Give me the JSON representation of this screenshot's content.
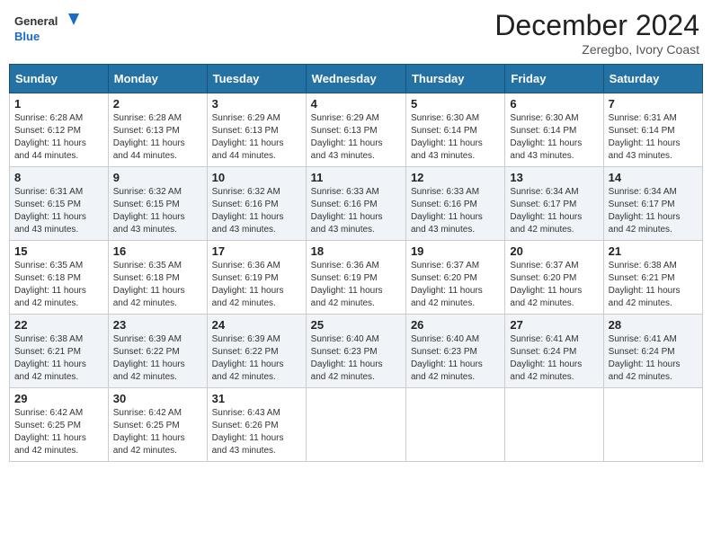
{
  "header": {
    "logo_general": "General",
    "logo_blue": "Blue",
    "month_title": "December 2024",
    "subtitle": "Zeregbo, Ivory Coast"
  },
  "days_of_week": [
    "Sunday",
    "Monday",
    "Tuesday",
    "Wednesday",
    "Thursday",
    "Friday",
    "Saturday"
  ],
  "weeks": [
    [
      {
        "day": 1,
        "sunrise": "6:28 AM",
        "sunset": "6:12 PM",
        "daylight": "11 hours and 44 minutes."
      },
      {
        "day": 2,
        "sunrise": "6:28 AM",
        "sunset": "6:13 PM",
        "daylight": "11 hours and 44 minutes."
      },
      {
        "day": 3,
        "sunrise": "6:29 AM",
        "sunset": "6:13 PM",
        "daylight": "11 hours and 44 minutes."
      },
      {
        "day": 4,
        "sunrise": "6:29 AM",
        "sunset": "6:13 PM",
        "daylight": "11 hours and 43 minutes."
      },
      {
        "day": 5,
        "sunrise": "6:30 AM",
        "sunset": "6:14 PM",
        "daylight": "11 hours and 43 minutes."
      },
      {
        "day": 6,
        "sunrise": "6:30 AM",
        "sunset": "6:14 PM",
        "daylight": "11 hours and 43 minutes."
      },
      {
        "day": 7,
        "sunrise": "6:31 AM",
        "sunset": "6:14 PM",
        "daylight": "11 hours and 43 minutes."
      }
    ],
    [
      {
        "day": 8,
        "sunrise": "6:31 AM",
        "sunset": "6:15 PM",
        "daylight": "11 hours and 43 minutes."
      },
      {
        "day": 9,
        "sunrise": "6:32 AM",
        "sunset": "6:15 PM",
        "daylight": "11 hours and 43 minutes."
      },
      {
        "day": 10,
        "sunrise": "6:32 AM",
        "sunset": "6:16 PM",
        "daylight": "11 hours and 43 minutes."
      },
      {
        "day": 11,
        "sunrise": "6:33 AM",
        "sunset": "6:16 PM",
        "daylight": "11 hours and 43 minutes."
      },
      {
        "day": 12,
        "sunrise": "6:33 AM",
        "sunset": "6:16 PM",
        "daylight": "11 hours and 43 minutes."
      },
      {
        "day": 13,
        "sunrise": "6:34 AM",
        "sunset": "6:17 PM",
        "daylight": "11 hours and 42 minutes."
      },
      {
        "day": 14,
        "sunrise": "6:34 AM",
        "sunset": "6:17 PM",
        "daylight": "11 hours and 42 minutes."
      }
    ],
    [
      {
        "day": 15,
        "sunrise": "6:35 AM",
        "sunset": "6:18 PM",
        "daylight": "11 hours and 42 minutes."
      },
      {
        "day": 16,
        "sunrise": "6:35 AM",
        "sunset": "6:18 PM",
        "daylight": "11 hours and 42 minutes."
      },
      {
        "day": 17,
        "sunrise": "6:36 AM",
        "sunset": "6:19 PM",
        "daylight": "11 hours and 42 minutes."
      },
      {
        "day": 18,
        "sunrise": "6:36 AM",
        "sunset": "6:19 PM",
        "daylight": "11 hours and 42 minutes."
      },
      {
        "day": 19,
        "sunrise": "6:37 AM",
        "sunset": "6:20 PM",
        "daylight": "11 hours and 42 minutes."
      },
      {
        "day": 20,
        "sunrise": "6:37 AM",
        "sunset": "6:20 PM",
        "daylight": "11 hours and 42 minutes."
      },
      {
        "day": 21,
        "sunrise": "6:38 AM",
        "sunset": "6:21 PM",
        "daylight": "11 hours and 42 minutes."
      }
    ],
    [
      {
        "day": 22,
        "sunrise": "6:38 AM",
        "sunset": "6:21 PM",
        "daylight": "11 hours and 42 minutes."
      },
      {
        "day": 23,
        "sunrise": "6:39 AM",
        "sunset": "6:22 PM",
        "daylight": "11 hours and 42 minutes."
      },
      {
        "day": 24,
        "sunrise": "6:39 AM",
        "sunset": "6:22 PM",
        "daylight": "11 hours and 42 minutes."
      },
      {
        "day": 25,
        "sunrise": "6:40 AM",
        "sunset": "6:23 PM",
        "daylight": "11 hours and 42 minutes."
      },
      {
        "day": 26,
        "sunrise": "6:40 AM",
        "sunset": "6:23 PM",
        "daylight": "11 hours and 42 minutes."
      },
      {
        "day": 27,
        "sunrise": "6:41 AM",
        "sunset": "6:24 PM",
        "daylight": "11 hours and 42 minutes."
      },
      {
        "day": 28,
        "sunrise": "6:41 AM",
        "sunset": "6:24 PM",
        "daylight": "11 hours and 42 minutes."
      }
    ],
    [
      {
        "day": 29,
        "sunrise": "6:42 AM",
        "sunset": "6:25 PM",
        "daylight": "11 hours and 42 minutes."
      },
      {
        "day": 30,
        "sunrise": "6:42 AM",
        "sunset": "6:25 PM",
        "daylight": "11 hours and 42 minutes."
      },
      {
        "day": 31,
        "sunrise": "6:43 AM",
        "sunset": "6:26 PM",
        "daylight": "11 hours and 43 minutes."
      },
      null,
      null,
      null,
      null
    ]
  ],
  "labels": {
    "sunrise": "Sunrise:",
    "sunset": "Sunset:",
    "daylight": "Daylight:"
  }
}
